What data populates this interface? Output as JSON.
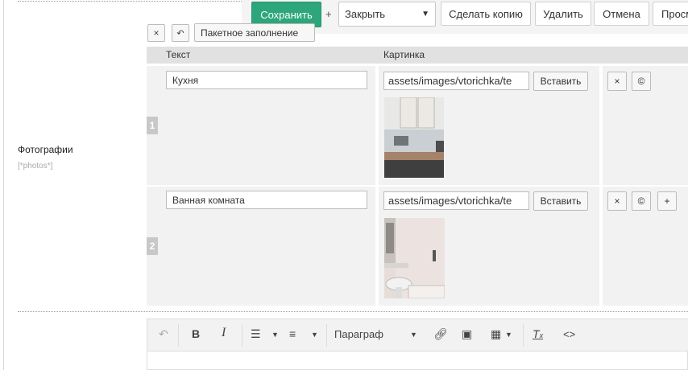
{
  "toolbar": {
    "save_label": "Сохранить",
    "plus": "+",
    "mode_value": "Закрыть",
    "copy_label": "Сделать копию",
    "delete_label": "Удалить",
    "cancel_label": "Отмена",
    "view_label": "Просм",
    "accent": "#2ea67b"
  },
  "field": {
    "label": "Фотографии",
    "placeholder": "[*photos*]"
  },
  "tv": {
    "batch_label": "Пакетное заполнение",
    "col_text": "Текст",
    "col_image": "Картинка",
    "insert_label": "Вставить",
    "rows": [
      {
        "num": "1",
        "text": "Кухня",
        "path": "assets/images/vtorichka/te"
      },
      {
        "num": "2",
        "text": "Ванная комната",
        "path": "assets/images/vtorichka/te"
      }
    ]
  },
  "editor": {
    "paragraph_label": "Параграф",
    "icons": [
      "undo-icon",
      "bold-icon",
      "italic-icon",
      "bullet-list-icon",
      "numbered-list-icon",
      "link-icon",
      "image-icon",
      "table-icon",
      "clear-format-icon",
      "code-icon"
    ]
  }
}
